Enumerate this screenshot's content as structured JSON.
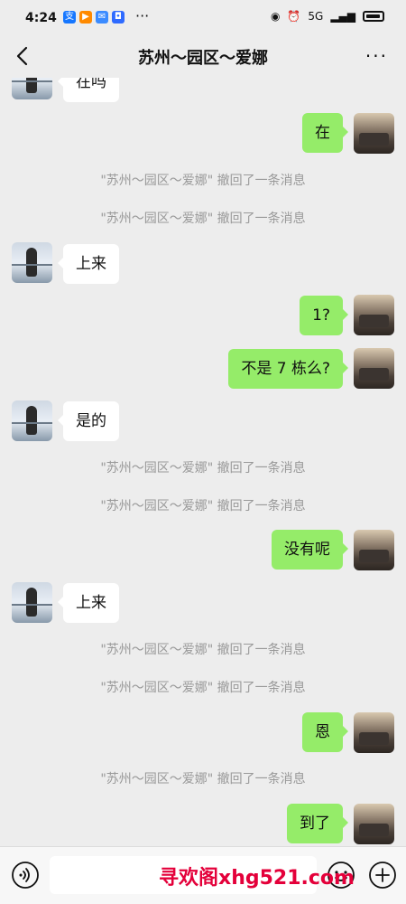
{
  "status_bar": {
    "time": "4:24",
    "apps": [
      {
        "icon": "alipay-icon",
        "glyph": "支",
        "color": "#1677ff"
      },
      {
        "icon": "video-icon",
        "glyph": "▶",
        "color": "#ff8a00"
      },
      {
        "icon": "mail-icon",
        "glyph": "✉",
        "color": "#3b8bff"
      },
      {
        "icon": "app-icon",
        "glyph": "◘",
        "color": "#2f6bff"
      }
    ],
    "network": "5G"
  },
  "header": {
    "title": "苏州～园区～爱娜",
    "back_icon": "chevron-left-icon",
    "more_label": "···"
  },
  "messages": [
    {
      "type": "left",
      "text": "在吗"
    },
    {
      "type": "right",
      "text": "在"
    },
    {
      "type": "system",
      "text": "\"苏州～园区～爱娜\" 撤回了一条消息"
    },
    {
      "type": "system",
      "text": "\"苏州～园区～爱娜\" 撤回了一条消息"
    },
    {
      "type": "left",
      "text": "上来"
    },
    {
      "type": "right",
      "text": "1?"
    },
    {
      "type": "right",
      "text": "不是 7 栋么?"
    },
    {
      "type": "left",
      "text": "是的"
    },
    {
      "type": "system",
      "text": "\"苏州～园区～爱娜\" 撤回了一条消息"
    },
    {
      "type": "system",
      "text": "\"苏州～园区～爱娜\" 撤回了一条消息"
    },
    {
      "type": "right",
      "text": "没有呢"
    },
    {
      "type": "left",
      "text": "上来"
    },
    {
      "type": "system",
      "text": "\"苏州～园区～爱娜\" 撤回了一条消息"
    },
    {
      "type": "system",
      "text": "\"苏州～园区～爱娜\" 撤回了一条消息"
    },
    {
      "type": "right",
      "text": "恩"
    },
    {
      "type": "system",
      "text": "\"苏州～园区～爱娜\" 撤回了一条消息"
    },
    {
      "type": "right",
      "text": "到了"
    }
  ],
  "input_bar": {
    "voice_icon": "voice-icon",
    "emoji_icon": "emoji-icon",
    "plus_icon": "plus-icon",
    "value": ""
  },
  "watermark": "寻欢阁xhg521.com",
  "colors": {
    "background": "#ededed",
    "bubble_self": "#95ec69",
    "bubble_other": "#ffffff",
    "system_text": "#999999",
    "watermark": "#e4003a"
  }
}
